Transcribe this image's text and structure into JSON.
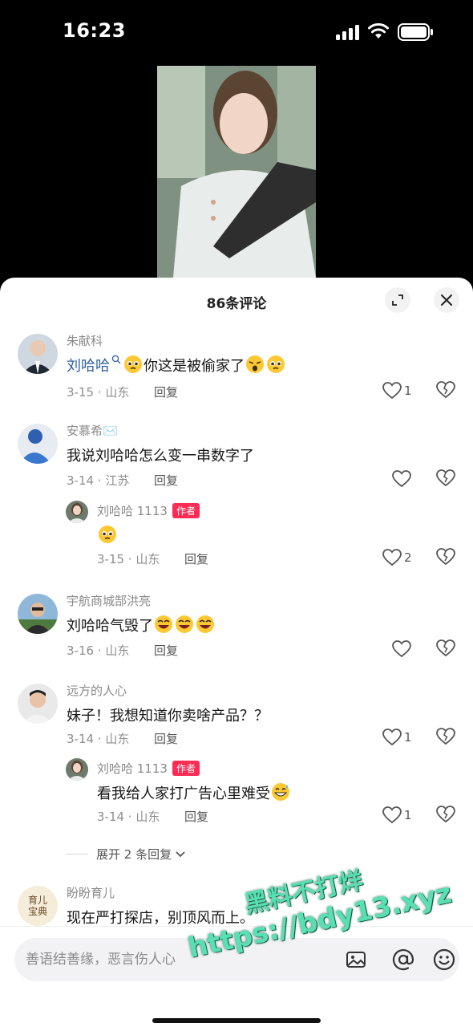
{
  "status_bar": {
    "time": "16:23"
  },
  "sheet": {
    "title": "86条评论",
    "comments": [
      {
        "user": "朱献科",
        "mention": "刘哈哈",
        "text": "你这是被偷家了",
        "date_loc": "3-15 · 山东",
        "reply_label": "回复",
        "likes": "1"
      },
      {
        "user": "安慕希✉️",
        "text": "我说刘哈哈怎么变一串数字了",
        "date_loc": "3-14 · 江苏",
        "reply_label": "回复",
        "likes": ""
      },
      {
        "user": "刘哈哈 1113",
        "author_tag": "作者",
        "text": "",
        "date_loc": "3-15 · 山东",
        "reply_label": "回复",
        "likes": "2"
      },
      {
        "user": "宇航商城郜洪亮",
        "text": "刘哈哈气毁了",
        "date_loc": "3-16 · 山东",
        "reply_label": "回复",
        "likes": ""
      },
      {
        "user": "远方的人心",
        "text": "妹子！我想知道你卖啥产品？？",
        "date_loc": "3-14 · 山东",
        "reply_label": "回复",
        "likes": "1"
      },
      {
        "user": "刘哈哈 1113",
        "author_tag": "作者",
        "text": "看我给人家打广告心里难受",
        "date_loc": "3-14 · 山东",
        "reply_label": "回复",
        "likes": "1"
      },
      {
        "user": "盼盼育儿",
        "avatar_text": [
          "育儿",
          "宝典"
        ],
        "text": "现在严打探店，别顶风而上。"
      }
    ],
    "expand_replies": "展开 2 条回复"
  },
  "input": {
    "placeholder": "善语结善缘，恶言伤人心"
  },
  "watermark": {
    "line1": "黑料不打烊",
    "line2": "https://bdy13.xyz"
  },
  "colors": {
    "author_tag": "#fe2c55",
    "mention": "#2f5fa3",
    "watermark": "#57e0b4"
  },
  "icons": [
    "signal-icon",
    "wifi-icon",
    "battery-icon",
    "expand-icon",
    "close-icon",
    "heart-icon",
    "broken-heart-icon",
    "chevron-down-icon",
    "image-icon",
    "at-icon",
    "smile-icon"
  ]
}
